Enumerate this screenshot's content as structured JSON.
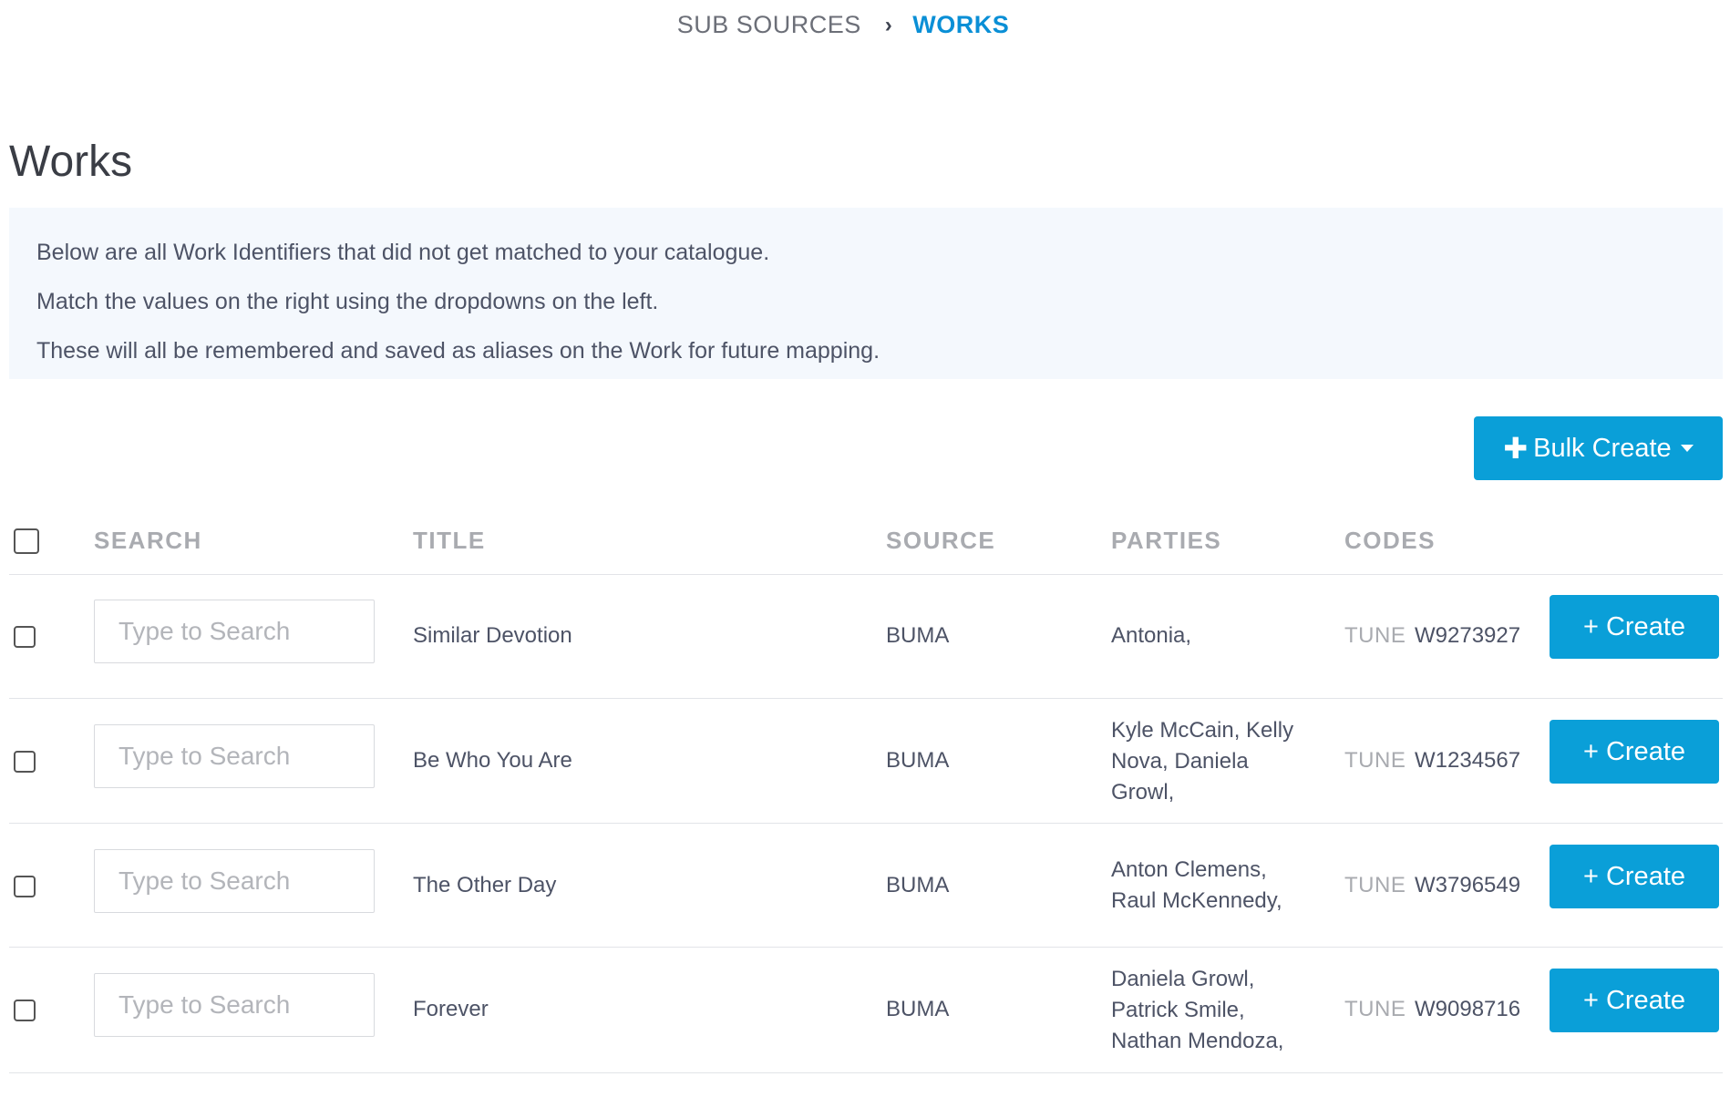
{
  "breadcrumb": {
    "parent": "SUB SOURCES",
    "separator": "›",
    "current": "WORKS"
  },
  "page": {
    "title": "Works"
  },
  "info": {
    "lines": [
      "Below are all Work Identifiers that did not get matched to your catalogue.",
      "Match the values on the right using the dropdowns on the left.",
      "These will all be remembered and saved as aliases on the Work for future mapping."
    ]
  },
  "toolbar": {
    "bulk_create_label": "Bulk Create",
    "bulk_create_icon": "plus-icon",
    "bulk_create_caret": "caret-down-icon"
  },
  "table": {
    "headers": {
      "search": "SEARCH",
      "title": "TITLE",
      "source": "SOURCE",
      "parties": "PARTIES",
      "codes": "CODES"
    },
    "rows": [
      {
        "search_placeholder": "Type to Search",
        "title": "Similar Devotion",
        "source": "BUMA",
        "parties": "Antonia,",
        "code_type": "TUNE",
        "code_value": "W9273927",
        "create_label": "+ Create"
      },
      {
        "search_placeholder": "Type to Search",
        "title": "Be Who You Are",
        "source": "BUMA",
        "parties": "Kyle McCain, Kelly Nova, Daniela Growl,",
        "code_type": "TUNE",
        "code_value": "W1234567",
        "create_label": "+ Create"
      },
      {
        "search_placeholder": "Type to Search",
        "title": "The Other Day",
        "source": "BUMA",
        "parties": "Anton Clemens, Raul McKennedy,",
        "code_type": "TUNE",
        "code_value": "W3796549",
        "create_label": "+ Create"
      },
      {
        "search_placeholder": "Type to Search",
        "title": "Forever",
        "source": "BUMA",
        "parties": "Daniela Growl, Patrick Smile, Nathan Mendoza,",
        "code_type": "TUNE",
        "code_value": "W9098716",
        "create_label": "+ Create"
      }
    ]
  },
  "colors": {
    "accent": "#0a9fd8",
    "breadcrumb_active": "#0a8fd6",
    "info_background": "#f4f8fd"
  }
}
